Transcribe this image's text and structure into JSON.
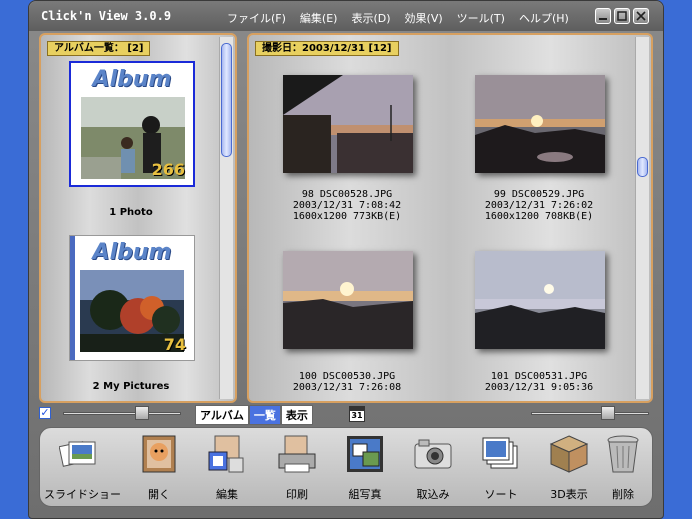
{
  "app": {
    "title": "Click'n View 3.0.9"
  },
  "menu": [
    {
      "label": "ファイル(F)"
    },
    {
      "label": "編集(E)"
    },
    {
      "label": "表示(D)"
    },
    {
      "label": "効果(V)"
    },
    {
      "label": "ツール(T)"
    },
    {
      "label": "ヘルプ(H)"
    }
  ],
  "left_panel": {
    "header": "アルバム一覧： [2]",
    "albums": [
      {
        "word": "Album",
        "count": "266",
        "caption": "1 Photo"
      },
      {
        "word": "Album",
        "count": "74",
        "caption": "2 My Pictures"
      }
    ]
  },
  "right_panel": {
    "header": "撮影日：2003/12/31  [12]",
    "photos": [
      {
        "line1": "98 DSC00528.JPG",
        "line2": "2003/12/31  7:08:42",
        "line3": "1600x1200  773KB(E)"
      },
      {
        "line1": "99 DSC00529.JPG",
        "line2": "2003/12/31  7:26:02",
        "line3": "1600x1200  708KB(E)"
      },
      {
        "line1": "100 DSC00530.JPG",
        "line2": "2003/12/31  7:26:08",
        "line3": ""
      },
      {
        "line1": "101 DSC00531.JPG",
        "line2": "2003/12/31  9:05:36",
        "line3": ""
      }
    ]
  },
  "controls": {
    "tabs": [
      {
        "label": "アルバム"
      },
      {
        "label": "一覧"
      },
      {
        "label": "表示"
      }
    ],
    "calendar_day": "31"
  },
  "toolbar": [
    {
      "label": "スライドショー",
      "icon": "slideshow-icon"
    },
    {
      "label": "開く",
      "icon": "open-icon"
    },
    {
      "label": "編集",
      "icon": "edit-icon"
    },
    {
      "label": "印刷",
      "icon": "print-icon"
    },
    {
      "label": "組写真",
      "icon": "collage-icon"
    },
    {
      "label": "取込み",
      "icon": "camera-icon"
    },
    {
      "label": "ソート",
      "icon": "sort-icon"
    },
    {
      "label": "3D表示",
      "icon": "cube-icon"
    },
    {
      "label": "削除",
      "icon": "trash-icon"
    }
  ]
}
